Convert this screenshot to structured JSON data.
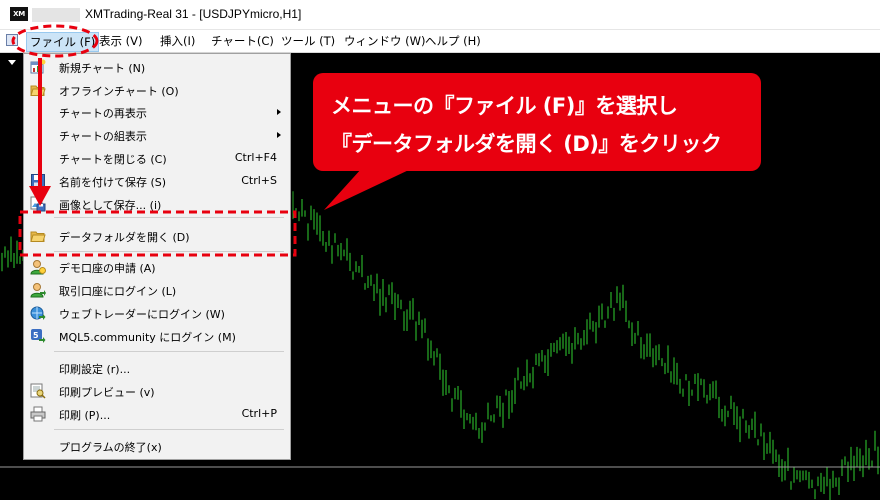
{
  "window": {
    "icon_text": "XM",
    "title": "XMTrading-Real 31 - [USDJPYmicro,H1]"
  },
  "menubar": {
    "items": [
      {
        "label": "ファイル (F)"
      },
      {
        "label": "表示 (V)"
      },
      {
        "label": "挿入(I)"
      },
      {
        "label": "チャート(C)"
      },
      {
        "label": "ツール (T)"
      },
      {
        "label": "ウィンドウ (W)"
      },
      {
        "label": "ヘルプ (H)"
      }
    ]
  },
  "file_menu": {
    "items": [
      {
        "label": "新規チャート (N)",
        "shortcut": "",
        "icon": "new-chart-icon"
      },
      {
        "label": "オフラインチャート (O)",
        "shortcut": "",
        "icon": "open-folder-icon"
      },
      {
        "label": "チャートの再表示",
        "shortcut": "",
        "icon": "",
        "submenu": true
      },
      {
        "label": "チャートの組表示",
        "shortcut": "",
        "icon": "",
        "submenu": true
      },
      {
        "label": "チャートを閉じる (C)",
        "shortcut": "Ctrl+F4",
        "icon": ""
      },
      {
        "label": "名前を付けて保存 (S)",
        "shortcut": "Ctrl+S",
        "icon": "save-icon"
      },
      {
        "label": "画像として保存... (i)",
        "shortcut": "",
        "icon": "save-image-icon"
      },
      {
        "label": "データフォルダを開く (D)",
        "shortcut": "",
        "icon": "folder-icon"
      },
      {
        "label": "デモ口座の申請 (A)",
        "shortcut": "",
        "icon": "demo-account-icon"
      },
      {
        "label": "取引口座にログイン (L)",
        "shortcut": "",
        "icon": "login-account-icon"
      },
      {
        "label": "ウェブトレーダーにログイン (W)",
        "shortcut": "",
        "icon": "webtrader-icon"
      },
      {
        "label": "MQL5.community にログイン (M)",
        "shortcut": "",
        "icon": "mql5-icon"
      },
      {
        "label": "印刷設定 (r)...",
        "shortcut": "",
        "icon": ""
      },
      {
        "label": "印刷プレビュー (v)",
        "shortcut": "",
        "icon": "print-preview-icon"
      },
      {
        "label": "印刷 (P)...",
        "shortcut": "Ctrl+P",
        "icon": "printer-icon"
      },
      {
        "label": "プログラムの終了(x)",
        "shortcut": "",
        "icon": ""
      }
    ]
  },
  "callout": {
    "line1": "メニューの『ファイル (F)』を選択し",
    "line2": "『データフォルダを開く (D)』をクリック"
  },
  "colors": {
    "annotation_red": "#e8000f",
    "chart_bars": "#2fcf2f",
    "chart_background": "#000000",
    "menu_background": "#f2f2f2"
  }
}
